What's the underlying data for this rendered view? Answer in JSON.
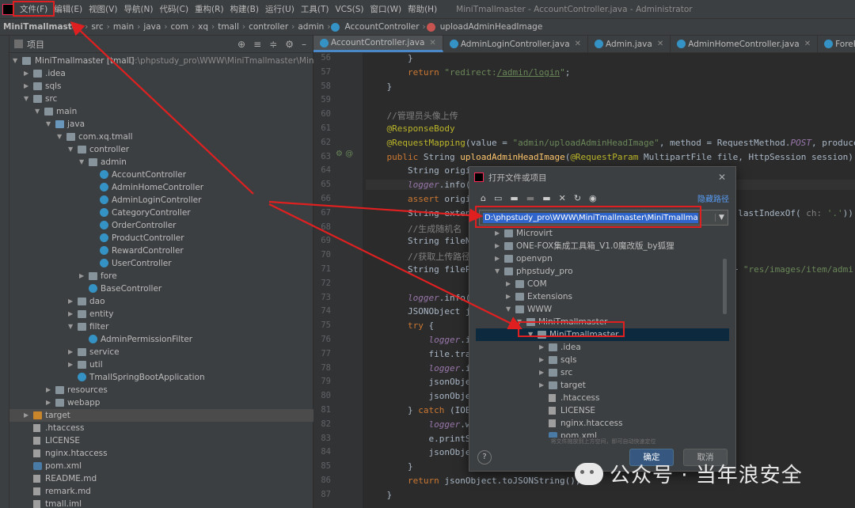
{
  "menubar": {
    "items": [
      "文件(F)",
      "编辑(E)",
      "视图(V)",
      "导航(N)",
      "代码(C)",
      "重构(R)",
      "构建(B)",
      "运行(U)",
      "工具(T)",
      "VCS(S)",
      "窗口(W)",
      "帮助(H)"
    ],
    "window_title": "MiniTmallmaster - AccountController.java - Administrator"
  },
  "breadcrumb": {
    "items": [
      "MiniTmallmaster",
      "src",
      "main",
      "java",
      "com",
      "xq",
      "tmall",
      "controller",
      "admin",
      "AccountController",
      "uploadAdminHeadImage"
    ]
  },
  "project_panel": {
    "title": "项目",
    "root_label": "MiniTmallmaster [tmall]",
    "root_path": "D:\\phpstudy_pro\\WWW\\MiniTmallmaster\\MiniTm",
    "rows": [
      {
        "label": ".idea",
        "depth": 1,
        "arrow": "▶",
        "icon": "folder"
      },
      {
        "label": "sqls",
        "depth": 1,
        "arrow": "▶",
        "icon": "folder"
      },
      {
        "label": "src",
        "depth": 1,
        "arrow": "▼",
        "icon": "folder"
      },
      {
        "label": "main",
        "depth": 2,
        "arrow": "▼",
        "icon": "folder"
      },
      {
        "label": "java",
        "depth": 3,
        "arrow": "▼",
        "icon": "folder-blue"
      },
      {
        "label": "com.xq.tmall",
        "depth": 4,
        "arrow": "▼",
        "icon": "folder"
      },
      {
        "label": "controller",
        "depth": 5,
        "arrow": "▼",
        "icon": "folder"
      },
      {
        "label": "admin",
        "depth": 6,
        "arrow": "▼",
        "icon": "folder"
      },
      {
        "label": "AccountController",
        "depth": 7,
        "arrow": "",
        "icon": "class"
      },
      {
        "label": "AdminHomeController",
        "depth": 7,
        "arrow": "",
        "icon": "class"
      },
      {
        "label": "AdminLoginController",
        "depth": 7,
        "arrow": "",
        "icon": "class"
      },
      {
        "label": "CategoryController",
        "depth": 7,
        "arrow": "",
        "icon": "class"
      },
      {
        "label": "OrderController",
        "depth": 7,
        "arrow": "",
        "icon": "class"
      },
      {
        "label": "ProductController",
        "depth": 7,
        "arrow": "",
        "icon": "class"
      },
      {
        "label": "RewardController",
        "depth": 7,
        "arrow": "",
        "icon": "class"
      },
      {
        "label": "UserController",
        "depth": 7,
        "arrow": "",
        "icon": "class"
      },
      {
        "label": "fore",
        "depth": 6,
        "arrow": "▶",
        "icon": "folder"
      },
      {
        "label": "BaseController",
        "depth": 6,
        "arrow": "",
        "icon": "class"
      },
      {
        "label": "dao",
        "depth": 5,
        "arrow": "▶",
        "icon": "folder"
      },
      {
        "label": "entity",
        "depth": 5,
        "arrow": "▶",
        "icon": "folder"
      },
      {
        "label": "filter",
        "depth": 5,
        "arrow": "▼",
        "icon": "folder"
      },
      {
        "label": "AdminPermissionFilter",
        "depth": 6,
        "arrow": "",
        "icon": "class"
      },
      {
        "label": "service",
        "depth": 5,
        "arrow": "▶",
        "icon": "folder"
      },
      {
        "label": "util",
        "depth": 5,
        "arrow": "▶",
        "icon": "folder"
      },
      {
        "label": "TmallSpringBootApplication",
        "depth": 5,
        "arrow": "",
        "icon": "class"
      },
      {
        "label": "resources",
        "depth": 3,
        "arrow": "▶",
        "icon": "folder"
      },
      {
        "label": "webapp",
        "depth": 3,
        "arrow": "▶",
        "icon": "folder"
      },
      {
        "label": "target",
        "depth": 1,
        "arrow": "▶",
        "icon": "folder-orange",
        "selected": true
      },
      {
        "label": ".htaccess",
        "depth": 1,
        "arrow": "",
        "icon": "file"
      },
      {
        "label": "LICENSE",
        "depth": 1,
        "arrow": "",
        "icon": "file"
      },
      {
        "label": "nginx.htaccess",
        "depth": 1,
        "arrow": "",
        "icon": "file"
      },
      {
        "label": "pom.xml",
        "depth": 1,
        "arrow": "",
        "icon": "maven"
      },
      {
        "label": "README.md",
        "depth": 1,
        "arrow": "",
        "icon": "file"
      },
      {
        "label": "remark.md",
        "depth": 1,
        "arrow": "",
        "icon": "file"
      },
      {
        "label": "tmall.iml",
        "depth": 1,
        "arrow": "",
        "icon": "file"
      }
    ]
  },
  "editor": {
    "tabs": [
      {
        "label": "AccountController.java",
        "active": true
      },
      {
        "label": "AdminLoginController.java",
        "active": false
      },
      {
        "label": "Admin.java",
        "active": false
      },
      {
        "label": "AdminHomeController.java",
        "active": false
      },
      {
        "label": "ForeRegisterControlle",
        "active": false
      }
    ],
    "line_numbers": [
      "56",
      "57",
      "58",
      "59",
      "60",
      "61",
      "62",
      "63",
      "64",
      "65",
      "66",
      "67",
      "68",
      "69",
      "70",
      "71",
      "72",
      "73",
      "74",
      "75",
      "76",
      "77",
      "78",
      "79",
      "80",
      "81",
      "82",
      "83",
      "84",
      "85",
      "86"
    ],
    "current_line": "65",
    "lines": [
      {
        "n": "56",
        "html": "        }"
      },
      {
        "n": "57",
        "html": "        <span class=\"kw\">return</span> <span class=\"st\">\"redirect:<u>/admin/login</u>\"</span>;"
      },
      {
        "n": "58",
        "html": "    }"
      },
      {
        "n": "59",
        "html": ""
      },
      {
        "n": "60",
        "html": "    <span class=\"cm\">//管理员头像上传</span>"
      },
      {
        "n": "61",
        "html": "    <span class=\"an\">@ResponseBody</span>"
      },
      {
        "n": "62",
        "html": "    <span class=\"an\">@RequestMapping</span>(value = <span class=\"st\">\"admin/uploadAdminHeadImage\"</span>, method = RequestMethod.<span class=\"it\">POST</span>, produce"
      },
      {
        "n": "63",
        "html": "    <span class=\"kw\">public</span> String <span class=\"fn\">uploadAdminHeadImage</span>(<span class=\"an\">@RequestParam</span> MultipartFile file, HttpSession session) {"
      },
      {
        "n": "64",
        "html": "        String originalFileName = file.getOriginalFilename();"
      },
      {
        "n": "65",
        "html": "        <span class=\"it\">logger</span>.info("
      },
      {
        "n": "66",
        "html": "        <span class=\"kw\">assert</span> origi"
      },
      {
        "n": "67",
        "html": "        String exten                                                  .lastIndexOf( <span class=\"cm\">ch:</span> <span class=\"st\">'.'</span>));"
      },
      {
        "n": "68",
        "html": "        <span class=\"cm\">//生成随机名</span>"
      },
      {
        "n": "69",
        "html": "        String fileN"
      },
      {
        "n": "70",
        "html": "        <span class=\"cm\">//获取上传路径</span>"
      },
      {
        "n": "71",
        "html": "        String fileP                                                  + <span class=\"st\">\"res/images/item/admi</span>"
      },
      {
        "n": "72",
        "html": ""
      },
      {
        "n": "73",
        "html": "        <span class=\"it\">logger</span>.info("
      },
      {
        "n": "74",
        "html": "        JSONObject j"
      },
      {
        "n": "75",
        "html": "        <span class=\"kw\">try</span> {"
      },
      {
        "n": "76",
        "html": "            <span class=\"it\">logger</span>.i"
      },
      {
        "n": "77",
        "html": "            file.tra"
      },
      {
        "n": "78",
        "html": "            <span class=\"it\">logger</span>.i"
      },
      {
        "n": "79",
        "html": "            jsonObje"
      },
      {
        "n": "80",
        "html": "            jsonObje"
      },
      {
        "n": "81",
        "html": "        } <span class=\"kw\">catch</span> (IOE"
      },
      {
        "n": "82",
        "html": "            <span class=\"it\">logger</span>.w"
      },
      {
        "n": "83",
        "html": "            e.printS"
      },
      {
        "n": "84",
        "html": "            jsonObje"
      },
      {
        "n": "85",
        "html": "        }"
      },
      {
        "n": "86",
        "html": "        <span class=\"kw\">return</span> jsonObject.toJSONString();"
      },
      {
        "n": "87",
        "html": "    }"
      }
    ]
  },
  "dialog": {
    "title": "打开文件或项目",
    "hide_path_label": "隐藏路径",
    "path_value": "D:\\phpstudy_pro\\WWW\\MiniTmallmaster\\MiniTmallmaster",
    "tree": [
      {
        "label": "Microvirt",
        "depth": 2,
        "arrow": "▶",
        "icon": "folder"
      },
      {
        "label": "ONE-FOX集成工具箱_V1.0魔改版_by狐狸",
        "depth": 2,
        "arrow": "▶",
        "icon": "folder"
      },
      {
        "label": "openvpn",
        "depth": 2,
        "arrow": "▶",
        "icon": "folder"
      },
      {
        "label": "phpstudy_pro",
        "depth": 2,
        "arrow": "▼",
        "icon": "folder"
      },
      {
        "label": "COM",
        "depth": 3,
        "arrow": "▶",
        "icon": "folder"
      },
      {
        "label": "Extensions",
        "depth": 3,
        "arrow": "▶",
        "icon": "folder"
      },
      {
        "label": "WWW",
        "depth": 3,
        "arrow": "▼",
        "icon": "folder"
      },
      {
        "label": "MiniTmallmaster",
        "depth": 4,
        "arrow": "▼",
        "icon": "folder"
      },
      {
        "label": "MiniTmallmaster",
        "depth": 5,
        "arrow": "▼",
        "icon": "folder",
        "selected": true
      },
      {
        "label": ".idea",
        "depth": 6,
        "arrow": "▶",
        "icon": "folder"
      },
      {
        "label": "sqls",
        "depth": 6,
        "arrow": "▶",
        "icon": "folder"
      },
      {
        "label": "src",
        "depth": 6,
        "arrow": "▶",
        "icon": "folder"
      },
      {
        "label": "target",
        "depth": 6,
        "arrow": "▶",
        "icon": "folder"
      },
      {
        "label": ".htaccess",
        "depth": 6,
        "arrow": "",
        "icon": "file"
      },
      {
        "label": "LICENSE",
        "depth": 6,
        "arrow": "",
        "icon": "file"
      },
      {
        "label": "nginx.htaccess",
        "depth": 6,
        "arrow": "",
        "icon": "file"
      },
      {
        "label": "pom.xml",
        "depth": 6,
        "arrow": "",
        "icon": "maven"
      }
    ],
    "hint": "将文件拖放到上方空间，即可自动快速定位",
    "ok_label": "确定",
    "cancel_label": "取消"
  },
  "watermark": {
    "text": "公众号 · 当年浪安全"
  }
}
